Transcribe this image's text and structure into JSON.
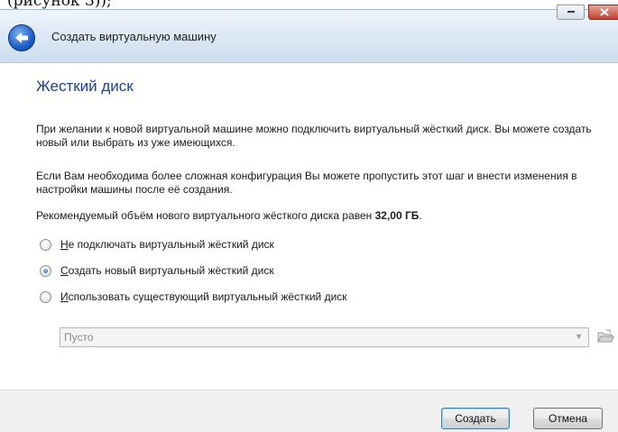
{
  "top_cropped_text": "(рисунок 3));",
  "window": {
    "title": "Создать виртуальную машину",
    "back_icon": "back-arrow-icon",
    "minimize_icon": "minimize-icon",
    "close_icon": "close-icon"
  },
  "page": {
    "heading": "Жесткий диск",
    "para1": "При желании к новой виртуальной машине можно подключить виртуальный жёсткий диск. Вы можете создать новый или выбрать из уже имеющихся.",
    "para2": "Если Вам необходима более сложная конфигурация Вы можете пропустить этот шаг и внести изменения в настройки машины после её создания.",
    "para3_prefix": "Рекомендуемый объём нового виртуального жёсткого диска равен ",
    "para3_value": "32,00 ГБ",
    "para3_suffix": "."
  },
  "options": [
    {
      "mnemonic": "Н",
      "rest": "е подключать виртуальный жёсткий диск",
      "checked": false
    },
    {
      "mnemonic": "С",
      "rest": "оздать новый виртуальный жёсткий диск",
      "checked": true
    },
    {
      "mnemonic": "И",
      "rest": "спользовать существующий виртуальный жёсткий диск",
      "checked": false
    }
  ],
  "existing_disk": {
    "selected": "Пусто",
    "enabled": false,
    "browse_icon": "folder-browse-icon"
  },
  "footer": {
    "create_label": "Создать",
    "cancel_label": "Отмена"
  },
  "colors": {
    "heading": "#1f3f8f",
    "titlebar": "#d9e6f3",
    "footer": "#f0f0f0"
  }
}
